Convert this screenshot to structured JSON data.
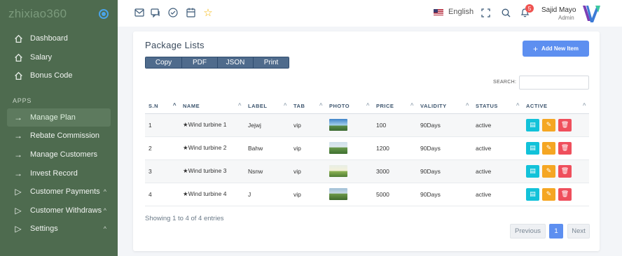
{
  "brand": {
    "name": "zhixiao360"
  },
  "sidebar": {
    "items": [
      {
        "label": "Dashboard",
        "icon": "home-icon"
      },
      {
        "label": "Salary",
        "icon": "home-icon"
      },
      {
        "label": "Bonus Code",
        "icon": "home-icon"
      }
    ],
    "section_label": "APPS",
    "app_items": [
      {
        "label": "Manage Plan",
        "icon": "arrow-right-icon",
        "active": true
      },
      {
        "label": "Rebate Commission",
        "icon": "arrow-right-icon"
      },
      {
        "label": "Manage Customers",
        "icon": "arrow-right-icon"
      },
      {
        "label": "Invest Record",
        "icon": "arrow-right-icon"
      },
      {
        "label": "Customer Payments",
        "icon": "play-icon",
        "expandable": true
      },
      {
        "label": "Customer Withdraws",
        "icon": "play-icon",
        "expandable": true
      },
      {
        "label": "Settings",
        "icon": "play-icon",
        "expandable": true
      }
    ]
  },
  "topbar": {
    "icons": [
      "mail-icon",
      "chat-icon",
      "check-circle-icon",
      "calendar-icon",
      "star-icon"
    ],
    "language": "English",
    "notification_count": "5",
    "user_name": "Sajid Mayo",
    "user_role": "Admin"
  },
  "card": {
    "title": "Package Lists",
    "add_button": "Add New Item",
    "export_buttons": [
      "Copy",
      "PDF",
      "JSON",
      "Print"
    ],
    "search_label": "SEARCH:",
    "search_value": ""
  },
  "table": {
    "columns": [
      "S.N",
      "NAME",
      "LABEL",
      "TAB",
      "PHOTO",
      "PRICE",
      "VALIDITY",
      "STATUS",
      "ACTIVE"
    ],
    "rows": [
      {
        "sn": "1",
        "name": "★Wind turbine 1",
        "label": "Jejwj",
        "tab": "vip",
        "price": "100",
        "validity": "90Days",
        "status": "active"
      },
      {
        "sn": "2",
        "name": "★Wind turbine 2",
        "label": "Bahw",
        "tab": "vip",
        "price": "1200",
        "validity": "90Days",
        "status": "active"
      },
      {
        "sn": "3",
        "name": "★Wind turbine 3",
        "label": "Nsnw",
        "tab": "vip",
        "price": "3000",
        "validity": "90Days",
        "status": "active"
      },
      {
        "sn": "4",
        "name": "★Wind turbine 4",
        "label": "J",
        "tab": "vip",
        "price": "5000",
        "validity": "90Days",
        "status": "active"
      }
    ]
  },
  "footer": {
    "info": "Showing 1 to 4 of 4 entries",
    "prev": "Previous",
    "current_page": "1",
    "next": "Next"
  },
  "colors": {
    "sidebar_bg": "#4e6b4f",
    "primary": "#5d8ff0",
    "view_button": "#12c2d9",
    "edit_button": "#f5a623",
    "delete_button": "#ef4f5c"
  }
}
